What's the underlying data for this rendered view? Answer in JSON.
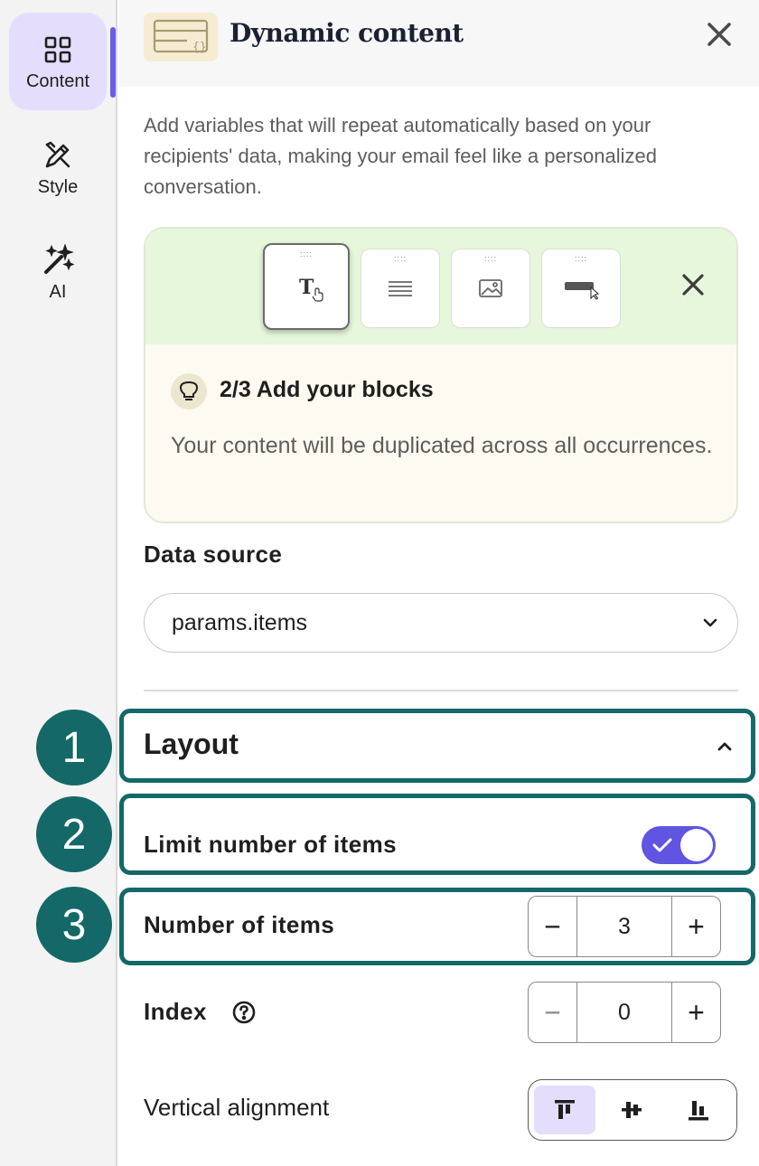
{
  "rail": {
    "items": [
      {
        "label": "Content",
        "icon": "grid-icon"
      },
      {
        "label": "Style",
        "icon": "brush-pen-icon"
      },
      {
        "label": "AI",
        "icon": "magic-wand-icon"
      }
    ]
  },
  "header": {
    "title": "Dynamic content",
    "icon": "dynamic-content-icon"
  },
  "description": "Add variables that will repeat automatically based on your recipients' data, making your email feel like a personalized conversation.",
  "tip": {
    "step_title": "2/3 Add your blocks",
    "text": "Your content will be duplicated across all occurrences.",
    "blocks": [
      "text-block-icon",
      "paragraph-block-icon",
      "image-block-icon",
      "button-block-icon"
    ]
  },
  "data_source": {
    "label": "Data source",
    "value": "params.items"
  },
  "layout": {
    "title": "Layout",
    "limit_label": "Limit number of items",
    "limit_enabled": true,
    "number_label": "Number of items",
    "number_value": "3",
    "index_label": "Index",
    "index_value": "0",
    "valign_label": "Vertical alignment",
    "valign_selected": "top"
  },
  "badges": [
    "1",
    "2",
    "3"
  ],
  "colors": {
    "accent": "#6054e0",
    "highlight": "#146868",
    "tip_green": "#e6f7dc",
    "tip_cream": "#fdfbf1"
  }
}
